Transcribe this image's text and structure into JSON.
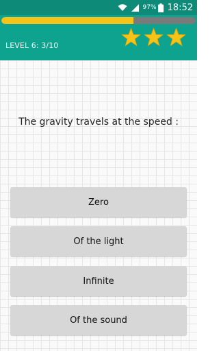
{
  "status_bar": {
    "battery_percent": "97%",
    "time": "18:52",
    "icons": [
      "wifi-icon",
      "signal-icon",
      "battery-icon"
    ]
  },
  "game": {
    "level_label": "LEVEL 6:",
    "question_progress": "3/10",
    "progress_fraction": 0.68,
    "stars_filled": 3,
    "stars_total": 3
  },
  "question": {
    "text": "The gravity travels at the speed :"
  },
  "answers": [
    {
      "label": "Zero"
    },
    {
      "label": "Of the light"
    },
    {
      "label": "Infinite"
    },
    {
      "label": "Of the sound"
    }
  ],
  "colors": {
    "status_bar": "#0d8a78",
    "header": "#0ea38e",
    "progress_fill": "#f6c418",
    "progress_track": "#7a7a7a",
    "star": "#f6c418",
    "answer_button": "#d6d7d6"
  }
}
